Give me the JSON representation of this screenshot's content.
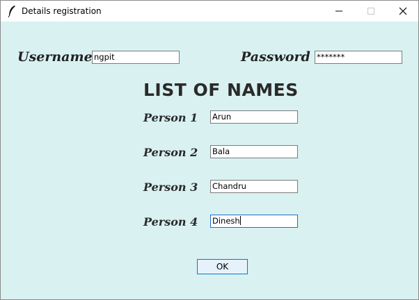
{
  "window": {
    "title": "Details registration"
  },
  "form": {
    "username_label": "Username",
    "username_value": "ngpit",
    "password_label": "Password",
    "password_value": "*******",
    "heading": "LIST OF NAMES",
    "persons": [
      {
        "label": "Person 1",
        "value": "Arun"
      },
      {
        "label": "Person 2",
        "value": "Bala"
      },
      {
        "label": "Person 3",
        "value": "Chandru"
      },
      {
        "label": "Person 4",
        "value": "Dinesh"
      }
    ],
    "ok_label": "OK"
  },
  "colors": {
    "background": "#d9f1f1",
    "focus_border": "#1b6fc8",
    "button_bg": "#e5f1fb",
    "button_border": "#0078d7"
  }
}
